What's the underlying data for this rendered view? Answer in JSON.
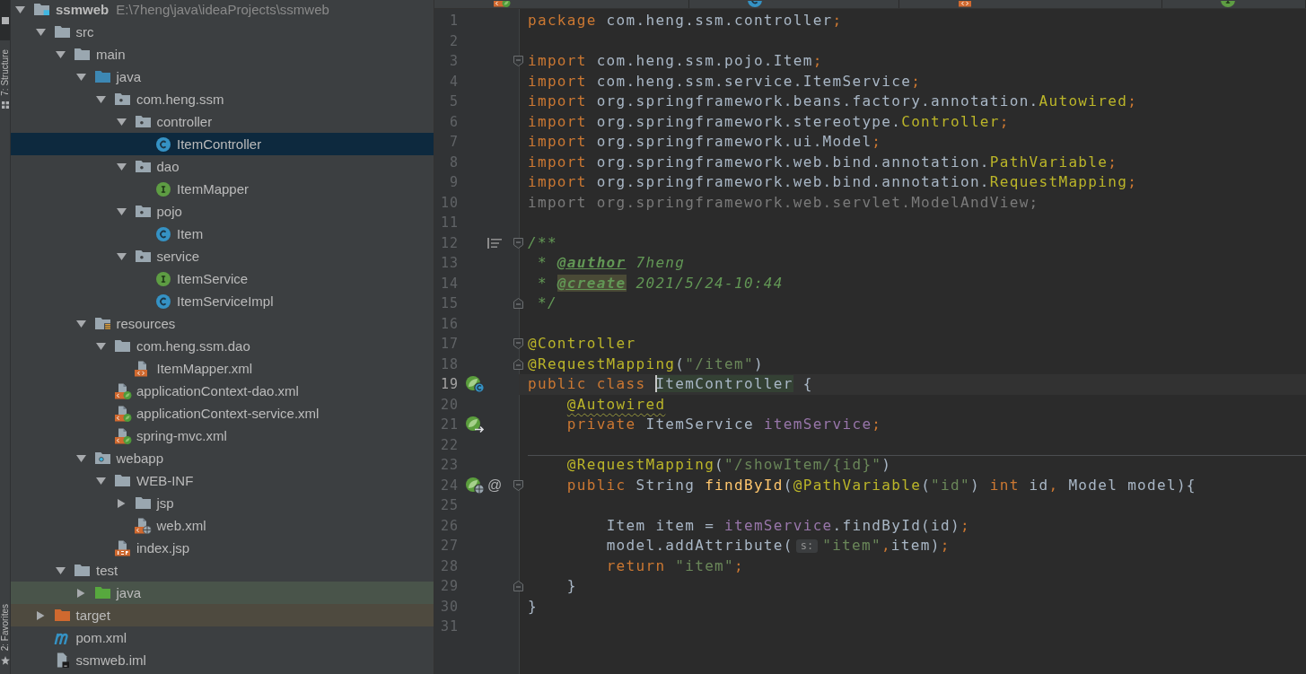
{
  "tool_window_bar": {
    "top": [
      {
        "kind": "project",
        "selected": true
      },
      {
        "kind": "structure",
        "label": "7: Structure",
        "selected": false
      }
    ],
    "bottom": [
      {
        "kind": "favorites",
        "label": "2: Favorites",
        "selected": false
      }
    ]
  },
  "project_tree": {
    "items": [
      {
        "label": "ssmweb",
        "path": "E:\\7heng\\java\\ideaProjects\\ssmweb",
        "kind": "module",
        "expanded": true,
        "selected": false,
        "children": [
          {
            "label": "src",
            "kind": "folder",
            "expanded": true,
            "selected": false,
            "children": [
              {
                "label": "main",
                "kind": "folder",
                "expanded": true,
                "selected": false,
                "children": [
                  {
                    "label": "java",
                    "kind": "source-root",
                    "expanded": true,
                    "selected": false,
                    "children": [
                      {
                        "label": "com.heng.ssm",
                        "kind": "package",
                        "expanded": true,
                        "selected": false,
                        "children": [
                          {
                            "label": "controller",
                            "kind": "package",
                            "expanded": true,
                            "selected": false,
                            "children": [
                              {
                                "label": "ItemController",
                                "kind": "class",
                                "selected": true
                              }
                            ]
                          },
                          {
                            "label": "dao",
                            "kind": "package",
                            "expanded": true,
                            "selected": false,
                            "children": [
                              {
                                "label": "ItemMapper",
                                "kind": "interface",
                                "selected": false
                              }
                            ]
                          },
                          {
                            "label": "pojo",
                            "kind": "package",
                            "expanded": true,
                            "selected": false,
                            "children": [
                              {
                                "label": "Item",
                                "kind": "class",
                                "selected": false
                              }
                            ]
                          },
                          {
                            "label": "service",
                            "kind": "package",
                            "expanded": true,
                            "selected": false,
                            "children": [
                              {
                                "label": "ItemService",
                                "kind": "interface",
                                "selected": false
                              },
                              {
                                "label": "ItemServiceImpl",
                                "kind": "class",
                                "selected": false
                              }
                            ]
                          }
                        ]
                      }
                    ]
                  },
                  {
                    "label": "resources",
                    "kind": "resources-root",
                    "expanded": true,
                    "selected": false,
                    "children": [
                      {
                        "label": "com.heng.ssm.dao",
                        "kind": "folder",
                        "expanded": true,
                        "selected": false,
                        "children": [
                          {
                            "label": "ItemMapper.xml",
                            "kind": "xml",
                            "selected": false
                          }
                        ]
                      },
                      {
                        "label": "applicationContext-dao.xml",
                        "kind": "spring-xml",
                        "selected": false
                      },
                      {
                        "label": "applicationContext-service.xml",
                        "kind": "spring-xml",
                        "selected": false
                      },
                      {
                        "label": "spring-mvc.xml",
                        "kind": "spring-xml",
                        "selected": false
                      }
                    ]
                  },
                  {
                    "label": "webapp",
                    "kind": "web-root",
                    "expanded": true,
                    "selected": false,
                    "children": [
                      {
                        "label": "WEB-INF",
                        "kind": "folder",
                        "expanded": true,
                        "selected": false,
                        "children": [
                          {
                            "label": "jsp",
                            "kind": "folder",
                            "expanded": false,
                            "selected": false
                          },
                          {
                            "label": "web.xml",
                            "kind": "web-xml",
                            "selected": false
                          }
                        ]
                      },
                      {
                        "label": "index.jsp",
                        "kind": "jsp",
                        "selected": false
                      }
                    ]
                  }
                ]
              },
              {
                "label": "test",
                "kind": "folder",
                "expanded": true,
                "selected": false,
                "children": [
                  {
                    "label": "java",
                    "kind": "test-root",
                    "expanded": false,
                    "selected": false
                  }
                ]
              }
            ]
          },
          {
            "label": "target",
            "kind": "excluded",
            "expanded": false,
            "selected": false
          },
          {
            "label": "pom.xml",
            "kind": "maven",
            "selected": false
          },
          {
            "label": "ssmweb.iml",
            "kind": "iml",
            "selected": false
          }
        ]
      }
    ]
  },
  "editor": {
    "tabs": [
      {
        "kind": "spring-xml",
        "selected": false
      },
      {
        "kind": "class",
        "selected": false
      },
      {
        "kind": "xml",
        "selected": false
      },
      {
        "kind": "interface",
        "selected": false
      }
    ],
    "lines": [
      {
        "n": "1",
        "current": false,
        "separator": false,
        "tokens": [
          {
            "kind": "keyword",
            "text": "package"
          },
          {
            "kind": "plain",
            "text": " com.heng.ssm.controller"
          },
          {
            "kind": "keyword",
            "text": ";"
          }
        ]
      },
      {
        "n": "2",
        "current": false,
        "separator": false
      },
      {
        "n": "3",
        "current": false,
        "separator": false,
        "gutter": [
          {
            "kind": "fold-start"
          }
        ],
        "tokens": [
          {
            "kind": "keyword",
            "text": "import"
          },
          {
            "kind": "plain",
            "text": " com.heng.ssm.pojo.Item"
          },
          {
            "kind": "keyword",
            "text": ";"
          }
        ]
      },
      {
        "n": "4",
        "current": false,
        "separator": false,
        "tokens": [
          {
            "kind": "keyword",
            "text": "import"
          },
          {
            "kind": "plain",
            "text": " com.heng.ssm.service.ItemService"
          },
          {
            "kind": "keyword",
            "text": ";"
          }
        ]
      },
      {
        "n": "5",
        "current": false,
        "separator": false,
        "tokens": [
          {
            "kind": "keyword",
            "text": "import"
          },
          {
            "kind": "plain",
            "text": " org.springframework.beans.factory.annotation."
          },
          {
            "kind": "annotation",
            "text": "Autowired"
          },
          {
            "kind": "keyword",
            "text": ";"
          }
        ]
      },
      {
        "n": "6",
        "current": false,
        "separator": false,
        "tokens": [
          {
            "kind": "keyword",
            "text": "import"
          },
          {
            "kind": "plain",
            "text": " org.springframework.stereotype."
          },
          {
            "kind": "annotation",
            "text": "Controller"
          },
          {
            "kind": "keyword",
            "text": ";"
          }
        ]
      },
      {
        "n": "7",
        "current": false,
        "separator": false,
        "tokens": [
          {
            "kind": "keyword",
            "text": "import"
          },
          {
            "kind": "plain",
            "text": " org.springframework.ui.Model"
          },
          {
            "kind": "keyword",
            "text": ";"
          }
        ]
      },
      {
        "n": "8",
        "current": false,
        "separator": false,
        "tokens": [
          {
            "kind": "keyword",
            "text": "import"
          },
          {
            "kind": "plain",
            "text": " org.springframework.web.bind.annotation."
          },
          {
            "kind": "annotation",
            "text": "PathVariable"
          },
          {
            "kind": "keyword",
            "text": ";"
          }
        ]
      },
      {
        "n": "9",
        "current": false,
        "separator": false,
        "tokens": [
          {
            "kind": "keyword",
            "text": "import"
          },
          {
            "kind": "plain",
            "text": " org.springframework.web.bind.annotation."
          },
          {
            "kind": "annotation",
            "text": "RequestMapping"
          },
          {
            "kind": "keyword",
            "text": ";"
          }
        ]
      },
      {
        "n": "10",
        "current": false,
        "separator": false,
        "tokens": [
          {
            "kind": "unused",
            "text": "import org.springframework.web.servlet.ModelAndView;"
          }
        ]
      },
      {
        "n": "11",
        "current": false,
        "separator": false
      },
      {
        "n": "12",
        "current": false,
        "separator": false,
        "gutter": [
          {
            "kind": "reader"
          },
          {
            "kind": "fold-start"
          }
        ],
        "tokens": [
          {
            "kind": "doc",
            "text": "/**"
          }
        ]
      },
      {
        "n": "13",
        "current": false,
        "separator": false,
        "tokens": [
          {
            "kind": "doc",
            "text": " * "
          },
          {
            "kind": "doctag",
            "text": "@author"
          },
          {
            "kind": "doc",
            "text": " 7heng"
          }
        ]
      },
      {
        "n": "14",
        "current": false,
        "separator": false,
        "tokens": [
          {
            "kind": "doc",
            "text": " * "
          },
          {
            "kind": "doctag-marked",
            "text": "@create"
          },
          {
            "kind": "doc",
            "text": " 2021/5/24-10:44"
          }
        ]
      },
      {
        "n": "15",
        "current": false,
        "separator": false,
        "gutter": [
          {
            "kind": "fold-end"
          }
        ],
        "tokens": [
          {
            "kind": "doc",
            "text": " */"
          }
        ]
      },
      {
        "n": "16",
        "current": false,
        "separator": false
      },
      {
        "n": "17",
        "current": false,
        "separator": false,
        "gutter": [
          {
            "kind": "fold-start"
          }
        ],
        "tokens": [
          {
            "kind": "annotation",
            "text": "@Controller"
          }
        ]
      },
      {
        "n": "18",
        "current": false,
        "separator": false,
        "gutter": [
          {
            "kind": "fold-end"
          }
        ],
        "tokens": [
          {
            "kind": "annotation",
            "text": "@RequestMapping"
          },
          {
            "kind": "plain",
            "text": "("
          },
          {
            "kind": "string",
            "text": "\"/item\""
          },
          {
            "kind": "plain",
            "text": ")"
          }
        ]
      },
      {
        "n": "19",
        "current": true,
        "separator": false,
        "gutter": [
          {
            "kind": "bean-class"
          }
        ],
        "tokens": [
          {
            "kind": "keyword",
            "text": "public class "
          },
          {
            "kind": "caret-ident",
            "text": "ItemController"
          },
          {
            "kind": "plain",
            "text": " {"
          }
        ]
      },
      {
        "n": "20",
        "current": false,
        "separator": false,
        "tokens": [
          {
            "kind": "annotation-warn",
            "text": "    @Autowired"
          }
        ]
      },
      {
        "n": "21",
        "current": false,
        "separator": false,
        "gutter": [
          {
            "kind": "bean-field"
          }
        ],
        "tokens": [
          {
            "kind": "keyword",
            "text": "    private"
          },
          {
            "kind": "plain",
            "text": " ItemService "
          },
          {
            "kind": "field",
            "text": "itemService"
          },
          {
            "kind": "keyword",
            "text": ";"
          }
        ]
      },
      {
        "n": "22",
        "current": false,
        "separator": false
      },
      {
        "n": "23",
        "current": false,
        "separator": true,
        "tokens": [
          {
            "kind": "annotation",
            "text": "    @RequestMapping"
          },
          {
            "kind": "plain",
            "text": "("
          },
          {
            "kind": "string",
            "text": "\"/showItem/{id}\""
          },
          {
            "kind": "plain",
            "text": ")"
          }
        ]
      },
      {
        "n": "24",
        "current": false,
        "separator": false,
        "gutter": [
          {
            "kind": "bean-web"
          },
          {
            "kind": "glyph",
            "text": "@"
          },
          {
            "kind": "fold-start"
          }
        ],
        "tokens": [
          {
            "kind": "keyword",
            "text": "    public"
          },
          {
            "kind": "plain",
            "text": " String "
          },
          {
            "kind": "method",
            "text": "findById"
          },
          {
            "kind": "plain",
            "text": "("
          },
          {
            "kind": "annotation",
            "text": "@PathVariable"
          },
          {
            "kind": "plain",
            "text": "("
          },
          {
            "kind": "string",
            "text": "\"id\""
          },
          {
            "kind": "plain",
            "text": ") "
          },
          {
            "kind": "keyword",
            "text": "int"
          },
          {
            "kind": "plain",
            "text": " id"
          },
          {
            "kind": "keyword",
            "text": ","
          },
          {
            "kind": "plain",
            "text": " Model model){"
          }
        ]
      },
      {
        "n": "25",
        "current": false,
        "separator": false
      },
      {
        "n": "26",
        "current": false,
        "separator": false,
        "tokens": [
          {
            "kind": "plain",
            "text": "        Item item = "
          },
          {
            "kind": "field",
            "text": "itemService"
          },
          {
            "kind": "plain",
            "text": ".findById(id)"
          },
          {
            "kind": "keyword",
            "text": ";"
          }
        ]
      },
      {
        "n": "27",
        "current": false,
        "separator": false,
        "tokens": [
          {
            "kind": "plain",
            "text": "        model.addAttribute("
          },
          {
            "kind": "hint",
            "text": "s:"
          },
          {
            "kind": "string",
            "text": "\"item\""
          },
          {
            "kind": "keyword",
            "text": ","
          },
          {
            "kind": "plain",
            "text": "item)"
          },
          {
            "kind": "keyword",
            "text": ";"
          }
        ]
      },
      {
        "n": "28",
        "current": false,
        "separator": false,
        "tokens": [
          {
            "kind": "keyword",
            "text": "        return "
          },
          {
            "kind": "string",
            "text": "\"item\""
          },
          {
            "kind": "keyword",
            "text": ";"
          }
        ]
      },
      {
        "n": "29",
        "current": false,
        "separator": false,
        "gutter": [
          {
            "kind": "fold-end"
          }
        ],
        "tokens": [
          {
            "kind": "plain",
            "text": "    }"
          }
        ]
      },
      {
        "n": "30",
        "current": false,
        "separator": false,
        "tokens": [
          {
            "kind": "plain",
            "text": "}"
          }
        ]
      },
      {
        "n": "31",
        "current": false,
        "separator": false
      }
    ]
  }
}
